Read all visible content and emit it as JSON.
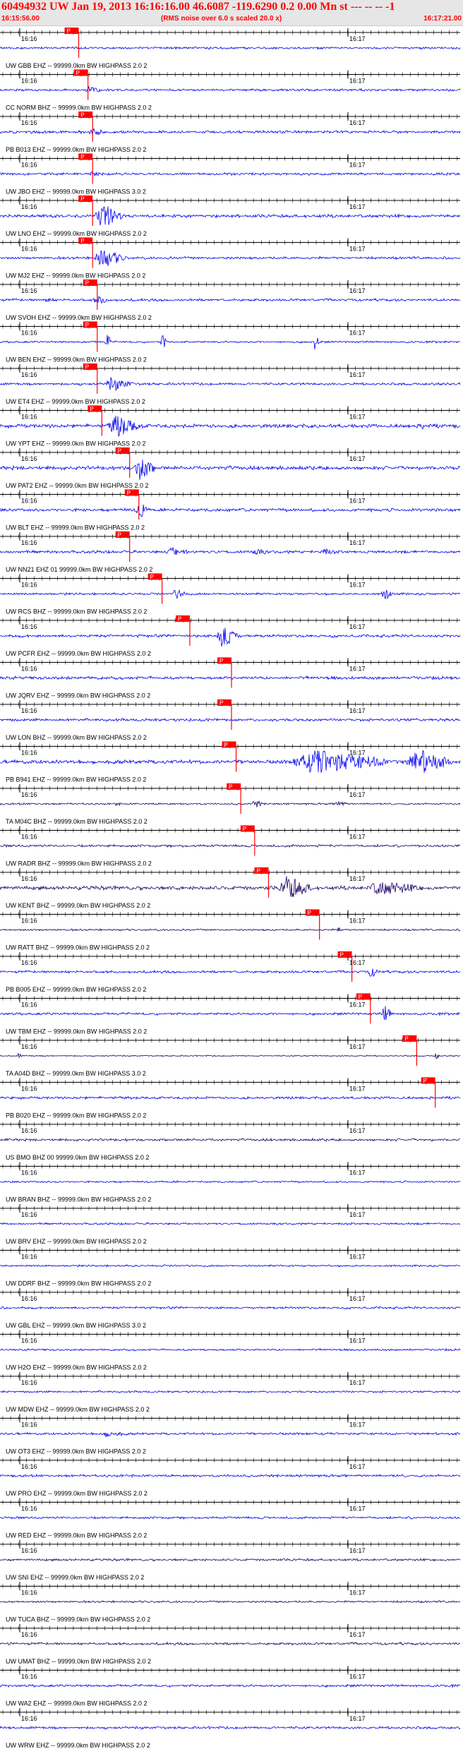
{
  "header": {
    "title": "60494932 UW Jan 19, 2013 16:16:16.00   46.6087 -119.6290  0.2 0.00 Mn st --- -- -- -1",
    "start_time": "16:15:56.00",
    "note": "(RMS noise over 6.0 s scaled 20.0 x)",
    "end_time": "16:17:21.00",
    "title_color": "#ff0000"
  },
  "chart_data": {
    "type": "line",
    "subtype": "seismogram_record_section",
    "time_range": [
      "16:15:56.00",
      "16:17:21.00"
    ],
    "time_tick_labels": [
      "16:16",
      "16:17"
    ],
    "pick_label": "P",
    "colors": {
      "trace_blue": "#0000ee",
      "trace_navy": "#1a0066",
      "pick": "#ff0000",
      "axis": "#000000"
    },
    "traces": [
      {
        "label": "UW GBB EHZ -- 99999.0km BW  HIGHPASS  2.0  2",
        "color": "#0000ee",
        "noise": 0.18,
        "pick_frac": 0.17,
        "events": []
      },
      {
        "label": "CC NORM BHZ -- 99999.0km BW  HIGHPASS  2.0  2",
        "color": "#0000ee",
        "noise": 0.18,
        "pick_frac": 0.19,
        "events": [
          [
            0.19,
            0.03,
            0.5
          ]
        ]
      },
      {
        "label": "PB B013 EHZ -- 99999.0km BW  HIGHPASS  2.0  2",
        "color": "#0000ee",
        "noise": 0.22,
        "pick_frac": 0.2,
        "events": [
          [
            0.2,
            0.03,
            0.5
          ]
        ]
      },
      {
        "label": "UW JBO EHZ -- 99999.0km BW  HIGHPASS  3.0  2",
        "color": "#0000ee",
        "noise": 0.2,
        "pick_frac": 0.2,
        "events": [
          [
            0.2,
            0.02,
            0.4
          ]
        ]
      },
      {
        "label": "UW LNO EHZ -- 99999.0km BW  HIGHPASS  2.0  2",
        "color": "#0000ee",
        "noise": 0.25,
        "pick_frac": 0.2,
        "events": [
          [
            0.22,
            0.05,
            2.4
          ]
        ]
      },
      {
        "label": "UW MJ2 EHZ -- 99999.0km BW  HIGHPASS  2.0  2",
        "color": "#0000ee",
        "noise": 0.2,
        "pick_frac": 0.2,
        "events": [
          [
            0.22,
            0.06,
            1.8
          ]
        ]
      },
      {
        "label": "UW SVOH EHZ -- 99999.0km BW  HIGHPASS  2.0  2",
        "color": "#0000ee",
        "noise": 0.2,
        "pick_frac": 0.21,
        "events": [
          [
            0.21,
            0.03,
            0.7
          ],
          [
            0.1,
            0.02,
            0.4
          ]
        ]
      },
      {
        "label": "UW BEN EHZ -- 99999.0km BW  HIGHPASS  2.0  2",
        "color": "#0000ee",
        "noise": 0.16,
        "pick_frac": 0.21,
        "events": [
          [
            0.23,
            0.01,
            2.2
          ],
          [
            0.35,
            0.01,
            2.2
          ],
          [
            0.68,
            0.01,
            2.2
          ]
        ]
      },
      {
        "label": "UW ET4 EHZ -- 99999.0km BW  HIGHPASS  2.0  2",
        "color": "#0000ee",
        "noise": 0.2,
        "pick_frac": 0.21,
        "events": [
          [
            0.24,
            0.05,
            1.2
          ]
        ]
      },
      {
        "label": "UW YPT EHZ -- 99999.0km BW  HIGHPASS  2.0  2",
        "color": "#0000ee",
        "noise": 0.3,
        "pick_frac": 0.22,
        "events": [
          [
            0.25,
            0.06,
            2.0
          ],
          [
            0.91,
            0.01,
            0.9
          ]
        ]
      },
      {
        "label": "UW PAT2 EHZ -- 99999.0km BW  HIGHPASS  2.0  2",
        "color": "#0000ee",
        "noise": 0.3,
        "pick_frac": 0.28,
        "events": [
          [
            0.3,
            0.04,
            2.3
          ]
        ]
      },
      {
        "label": "UW BLT EHZ -- 99999.0km BW  HIGHPASS  2.0  2",
        "color": "#0000ee",
        "noise": 0.25,
        "pick_frac": 0.3,
        "events": [
          [
            0.3,
            0.02,
            2.0
          ]
        ]
      },
      {
        "label": "UW NN21 EHZ 01 99999.0km BW  HIGHPASS  2.0  2",
        "color": "#0000ee",
        "noise": 0.22,
        "pick_frac": 0.28,
        "events": [
          [
            0.37,
            0.04,
            0.7
          ],
          [
            0.55,
            0.03,
            0.5
          ],
          [
            0.7,
            0.03,
            0.4
          ]
        ]
      },
      {
        "label": "UW RCS BHZ -- 99999.0km BW  HIGHPASS  2.0  2",
        "color": "#0000ee",
        "noise": 0.18,
        "pick_frac": 0.35,
        "events": [
          [
            0.38,
            0.03,
            0.8
          ],
          [
            0.83,
            0.02,
            1.4
          ]
        ]
      },
      {
        "label": "UW PCFR EHZ -- 99999.0km BW  HIGHPASS  2.0  2",
        "color": "#0000ee",
        "noise": 0.22,
        "pick_frac": 0.41,
        "events": [
          [
            0.48,
            0.04,
            2.4
          ]
        ]
      },
      {
        "label": "UW JQRV EHZ -- 99999.0km BW  HIGHPASS  2.0  2",
        "color": "#0000ee",
        "noise": 0.25,
        "pick_frac": 0.5,
        "events": []
      },
      {
        "label": "UW LON BHZ -- 99999.0km BW  HIGHPASS  2.0  2",
        "color": "#0000ee",
        "noise": 0.22,
        "pick_frac": 0.5,
        "events": []
      },
      {
        "label": "PB B941 EHZ -- 99999.0km BW  HIGHPASS  2.0  2",
        "color": "#0000ee",
        "noise": 0.3,
        "pick_frac": 0.51,
        "events": [
          [
            0.68,
            0.18,
            2.2
          ],
          [
            0.9,
            0.08,
            2.4
          ]
        ]
      },
      {
        "label": "TA M04C BHZ -- 99999.0km BW  HIGHPASS  2.0  2",
        "color": "#1a0066",
        "noise": 0.15,
        "pick_frac": 0.52,
        "events": [
          [
            0.55,
            0.02,
            0.7
          ],
          [
            0.73,
            0.02,
            0.8
          ],
          [
            0.25,
            0.01,
            0.4
          ]
        ]
      },
      {
        "label": "UW RADR BHZ -- 99999.0km BW  HIGHPASS  2.0  2",
        "color": "#1a0066",
        "noise": 0.2,
        "pick_frac": 0.55,
        "events": []
      },
      {
        "label": "UW KENT BHZ -- 99999.0km BW  HIGHPASS  2.0  2",
        "color": "#1a0066",
        "noise": 0.3,
        "pick_frac": 0.58,
        "events": [
          [
            0.62,
            0.06,
            2.2
          ],
          [
            0.82,
            0.1,
            1.2
          ]
        ]
      },
      {
        "label": "UW RATT BHZ -- 99999.0km BW  HIGHPASS  2.0  2",
        "color": "#1a0066",
        "noise": 0.15,
        "pick_frac": 0.69,
        "events": [
          [
            0.73,
            0.01,
            0.6
          ]
        ]
      },
      {
        "label": "PB B005 EHZ -- 99999.0km BW  HIGHPASS  2.0  2",
        "color": "#0000ee",
        "noise": 0.2,
        "pick_frac": 0.76,
        "events": [
          [
            0.8,
            0.02,
            1.0
          ]
        ]
      },
      {
        "label": "UW TBM EHZ -- 99999.0km BW  HIGHPASS  2.0  2",
        "color": "#0000ee",
        "noise": 0.2,
        "pick_frac": 0.8,
        "events": [
          [
            0.83,
            0.02,
            1.6
          ]
        ]
      },
      {
        "label": "TA A04D BHZ -- 99999.0km BW  HIGHPASS  3.0  2",
        "color": "#1a0066",
        "noise": 0.1,
        "pick_frac": 0.9,
        "events": [
          [
            0.04,
            0.01,
            0.5
          ],
          [
            0.94,
            0.01,
            0.8
          ]
        ]
      },
      {
        "label": "PB B020 EHZ -- 99999.0km BW  HIGHPASS  2.0  2",
        "color": "#0000ee",
        "noise": 0.2,
        "pick_frac": 0.94,
        "events": []
      },
      {
        "label": "US BMO BHZ 00 99999.0km BW  HIGHPASS  2.0  2",
        "color": "#1a0066",
        "noise": 0.2,
        "pick_frac": null,
        "events": []
      },
      {
        "label": "UW BRAN BHZ -- 99999.0km BW  HIGHPASS  2.0  2",
        "color": "#0000ee",
        "noise": 0.15,
        "pick_frac": null,
        "events": []
      },
      {
        "label": "UW BRV EHZ -- 99999.0km BW  HIGHPASS  2.0  2",
        "color": "#0000ee",
        "noise": 0.16,
        "pick_frac": null,
        "events": []
      },
      {
        "label": "UW DDRF BHZ -- 99999.0km BW  HIGHPASS  2.0  2",
        "color": "#0000ee",
        "noise": 0.15,
        "pick_frac": null,
        "events": []
      },
      {
        "label": "UW GBL EHZ -- 99999.0km BW  HIGHPASS  3.0  2",
        "color": "#0000ee",
        "noise": 0.18,
        "pick_frac": null,
        "events": []
      },
      {
        "label": "UW H2O EHZ -- 99999.0km BW  HIGHPASS  2.0  2",
        "color": "#0000ee",
        "noise": 0.16,
        "pick_frac": null,
        "events": []
      },
      {
        "label": "UW MDW EHZ -- 99999.0km BW  HIGHPASS  2.0  2",
        "color": "#0000ee",
        "noise": 0.16,
        "pick_frac": null,
        "events": []
      },
      {
        "label": "UW OT3 EHZ -- 99999.0km BW  HIGHPASS  2.0  2",
        "color": "#0000ee",
        "noise": 0.18,
        "pick_frac": null,
        "events": [
          [
            0.23,
            0.05,
            0.5
          ]
        ]
      },
      {
        "label": "UW PRO EHZ -- 99999.0km BW  HIGHPASS  2.0  2",
        "color": "#0000ee",
        "noise": 0.2,
        "pick_frac": null,
        "events": []
      },
      {
        "label": "UW RED EHZ -- 99999.0km BW  HIGHPASS  2.0  2",
        "color": "#0000ee",
        "noise": 0.18,
        "pick_frac": null,
        "events": []
      },
      {
        "label": "UW SNI EHZ -- 99999.0km BW  HIGHPASS  2.0  2",
        "color": "#1a0066",
        "noise": 0.18,
        "pick_frac": null,
        "events": []
      },
      {
        "label": "UW TUCA BHZ -- 99999.0km BW  HIGHPASS  2.0  2",
        "color": "#1a0066",
        "noise": 0.16,
        "pick_frac": null,
        "events": []
      },
      {
        "label": "UW UMAT BHZ -- 99999.0km BW  HIGHPASS  2.0  2",
        "color": "#1a0066",
        "noise": 0.2,
        "pick_frac": null,
        "events": []
      },
      {
        "label": "UW WA2 EHZ -- 99999.0km BW  HIGHPASS  2.0  2",
        "color": "#0000ee",
        "noise": 0.2,
        "pick_frac": null,
        "events": []
      },
      {
        "label": "UW WRW EHZ -- 99999.0km BW  HIGHPASS  2.0  2",
        "color": "#0000ee",
        "noise": 0.2,
        "pick_frac": null,
        "events": []
      }
    ]
  }
}
